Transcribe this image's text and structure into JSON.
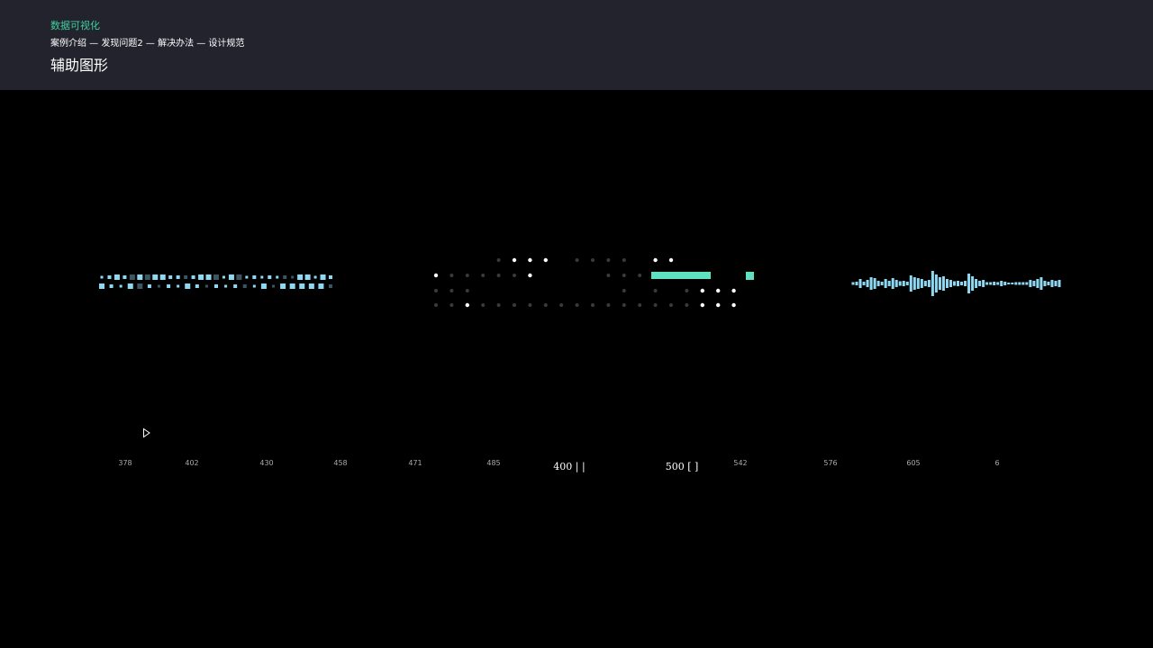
{
  "header": {
    "category": "数据可视化",
    "breadcrumb": "案例介绍 — 发现问题2 — 解决办法 — 设计规范",
    "title": "辅助图形"
  },
  "colors": {
    "header_bg": "#22232d",
    "accent": "#3fd0a0",
    "square_light": "#8fd8f2",
    "square_dark": "#3c5560",
    "dot_bright": "#ffffff",
    "dot_dim": "#3a3a3a",
    "bar_teal": "#5fe0c0",
    "wave": "#8fd8f2"
  },
  "ticks": [
    {
      "label": "378",
      "big": false
    },
    {
      "label": "402",
      "big": false
    },
    {
      "label": "430",
      "big": false
    },
    {
      "label": "458",
      "big": false
    },
    {
      "label": "471",
      "big": false
    },
    {
      "label": "485",
      "big": false
    },
    {
      "label": "400 | |",
      "big": true
    },
    {
      "label": "500 [ ]",
      "big": true
    },
    {
      "label": "542",
      "big": false
    },
    {
      "label": "576",
      "big": false
    },
    {
      "label": "605",
      "big": false
    },
    {
      "label": "6",
      "big": false
    }
  ],
  "icons": {
    "play": "play-icon"
  }
}
